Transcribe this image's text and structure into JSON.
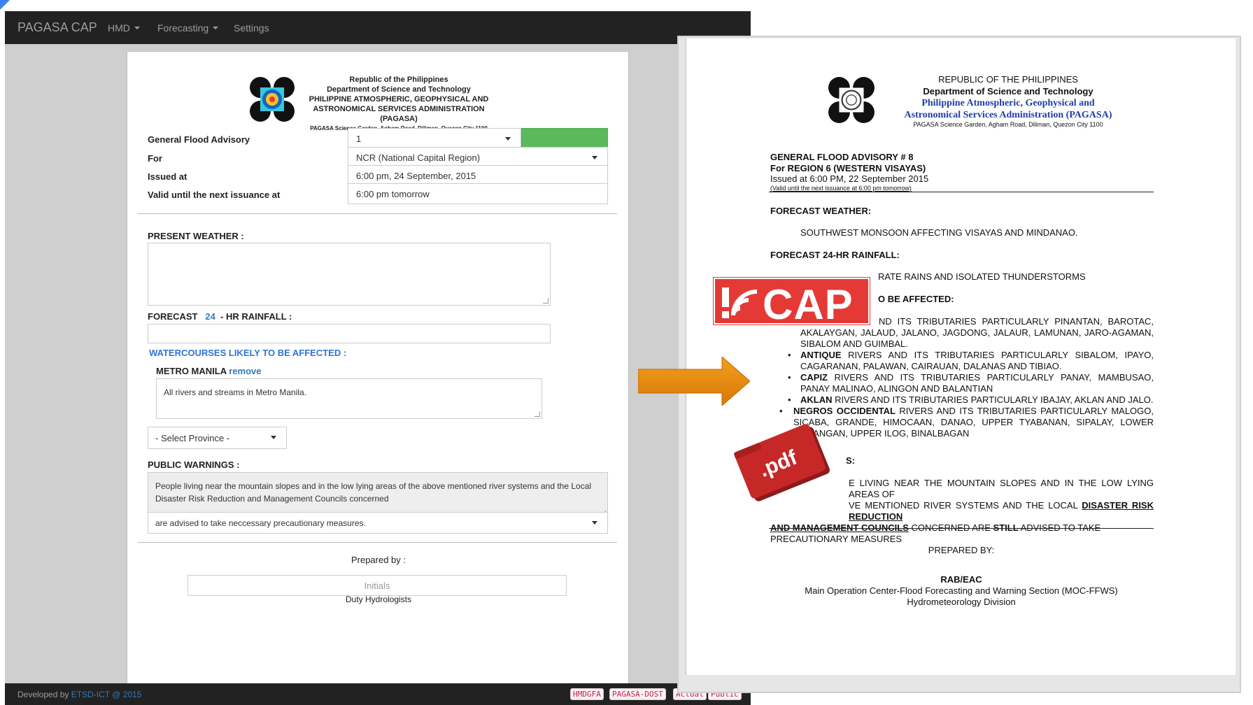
{
  "app": {
    "brand": "PAGASA CAP",
    "nav": [
      "HMD",
      "Forecasting",
      "Settings"
    ]
  },
  "header": {
    "line1": "Republic of the Philippines",
    "line2": "Department of Science and Technology",
    "line3": "PHILIPPINE ATMOSPHERIC, GEOPHYSICAL AND",
    "line4": "ASTRONOMICAL SERVICES ADMINISTRATION (PAGASA)",
    "line5": "PAGASA Science Garden, Agham Road, Diliman, Quezon City 1100"
  },
  "form": {
    "advisory_label": "General Flood Advisory",
    "advisory_value": "1",
    "for_label": "For",
    "for_value": "NCR (National Capital Region)",
    "issued_label": "Issued at",
    "issued_value": "6:00 pm, 24 September, 2015",
    "valid_label": "Valid until the next issuance at",
    "valid_value": "6:00 pm tomorrow",
    "present_weather_label": "PRESENT WEATHER :",
    "present_weather_value": "",
    "rainfall_prefix": "FORECAST",
    "rainfall_hours": "24",
    "rainfall_suffix": "- HR RAINFALL :",
    "rainfall_value": "",
    "watercourses_label": "WATERCOURSES LIKELY TO BE AFFECTED :",
    "region_name": "METRO MANILA",
    "remove_label": "remove",
    "region_text": "All rivers and streams in Metro Manila.",
    "province_placeholder": "- Select Province -",
    "public_warnings_label": "PUBLIC WARNINGS :",
    "public_warnings_text": "People living near the mountain slopes and in the low lying areas of the above mentioned river systems and the Local Disaster Risk Reduction and Management Councils concerned",
    "public_warnings_select": "are advised to take neccessary precautionary measures.",
    "prepared_label": "Prepared by :",
    "initials_placeholder": "Initials",
    "duty_label": "Duty Hydrologists"
  },
  "footer": {
    "developed": "Developed by",
    "org": "ETSD-ICT @ 2015",
    "tags": [
      "HMDGFA",
      "PAGASA-DOST",
      "Actual",
      "Public"
    ]
  },
  "document": {
    "h1": "REPUBLIC OF THE PHILIPPINES",
    "h2": "Department of Science and Technology",
    "h3": "Philippine Atmospheric, Geophysical and",
    "h4": "Astronomical Services Administration (PAGASA)",
    "h5": "PAGASA Science Garden, Agham Road, Diliman, Quezon City 1100",
    "title": "GENERAL FLOOD ADVISORY # 8",
    "for": "For REGION 6 (WESTERN VISAYAS)",
    "issued": "Issued at 6:00 PM, 22 September 2015",
    "valid": "(Valid until the next issuance at 6:00 pm tomorrow)",
    "fw_label": "FORECAST WEATHER:",
    "fw_text": "SOUTHWEST MONSOON AFFECTING VISAYAS AND MINDANAO.",
    "fr_label": "FORECAST 24-HR RAINFALL:",
    "fr_text": "RATE RAINS AND ISOLATED THUNDERSTORMS",
    "wc_label": "O BE AFFECTED:",
    "wc1": "ND ITS TRIBUTARIES PARTICULARLY PINANTAN, BAROTAC, AKALAYGAN, JALAUD, JALANO, JAGDONG, JALAUR, LAMUNAN, JARO-AGAMAN, SIBALOM AND GUIMBAL.",
    "wc2_bold": "ANTIQUE",
    "wc2": "RIVERS AND ITS TRIBUTARIES PARTICULARLY SIBALOM, IPAYO, CAGARANAN, PALAWAN, CAIRAUAN, DALANAS AND TIBIAO.",
    "wc3_bold": "CAPIZ",
    "wc3": "RIVERS AND ITS TRIBUTARIES PARTICULARLY PANAY, MAMBUSAO, PANAY MALINAO, ALINGON AND BALANTIAN",
    "wc4_bold": "AKLAN",
    "wc4": "RIVERS AND ITS TRIBUTARIES PARTICULARLY IBAJAY, AKLAN AND JALO.",
    "wc5_bold": "NEGROS OCCIDENTAL",
    "wc5": "RIVERS AND ITS TRIBUTARIES PARTICULARLY MALOGO, SICABA, GRANDE, HIMOCAAN, DANAO, UPPER TYABANAN, SIPALAY, LOWER ILABANGAN, UPPER ILOG, BINALBAGAN",
    "pw_label": "S:",
    "pw_text1": "E LIVING NEAR THE MOUNTAIN SLOPES AND IN THE LOW LYING AREAS OF",
    "pw_text2a": "VE MENTIONED RIVER SYSTEMS AND THE LOCAL",
    "pw_text2b": "DISASTER RISK REDUCTION",
    "pw_text3a": "AND MANAGEMENT COUNCILS",
    "pw_text3b": "CONCERNED ARE",
    "pw_text3c": "STILL",
    "pw_text3d": "ADVISED TO TAKE",
    "pw_text4": "PRECAUTIONARY MEASURES",
    "prepared": "PREPARED BY:",
    "signer": "RAB/EAC",
    "section": "Main Operation Center-Flood Forecasting and Warning Section (MOC-FFWS)",
    "division": "Hydrometeorology Division"
  },
  "overlays": {
    "cap_text": "CAP",
    "pdf_text": ".pdf"
  },
  "colors": {
    "navbar": "#222222",
    "green": "#5cb85c",
    "link": "#337ab7",
    "cap_red": "#e53935",
    "pdf_red": "#c62828",
    "arrow": "#e8890c"
  }
}
